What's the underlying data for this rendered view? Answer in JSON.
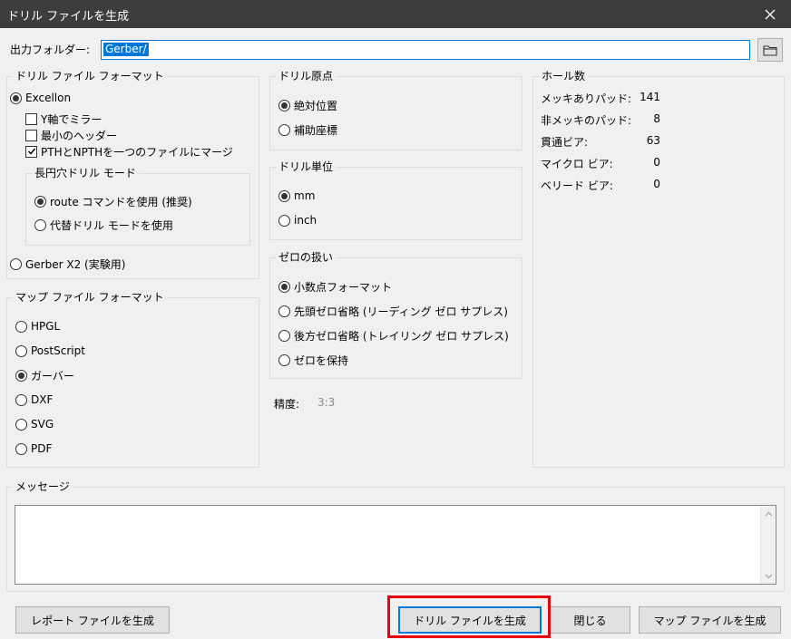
{
  "window": {
    "title": "ドリル ファイルを生成",
    "close_icon": "close-icon"
  },
  "output": {
    "label": "出力フォルダー:",
    "value": "Gerber/",
    "browse_icon": "folder-icon"
  },
  "drill_format": {
    "title": "ドリル ファイル フォーマット",
    "excellon": "Excellon",
    "mirror_y": "Y軸でミラー",
    "min_header": "最小のヘッダー",
    "merge_pth": "PTHとNPTHを一つのファイルにマージ",
    "oval": {
      "title": "長円穴ドリル モード",
      "route": "route コマンドを使用 (推奨)",
      "alt": "代替ドリル モードを使用"
    },
    "gerber_x2": "Gerber X2 (実験用)"
  },
  "map_format": {
    "title": "マップ ファイル フォーマット",
    "options": [
      "HPGL",
      "PostScript",
      "ガーバー",
      "DXF",
      "SVG",
      "PDF"
    ],
    "selected": "ガーバー"
  },
  "origin": {
    "title": "ドリル原点",
    "options": [
      "絶対位置",
      "補助座標"
    ]
  },
  "units": {
    "title": "ドリル単位",
    "options": [
      "mm",
      "inch"
    ]
  },
  "zeros": {
    "title": "ゼロの扱い",
    "options": [
      "小数点フォーマット",
      "先頭ゼロ省略 (リーディング ゼロ サプレス)",
      "後方ゼロ省略 (トレイリング ゼロ サプレス)",
      "ゼロを保持"
    ]
  },
  "precision": {
    "label": "精度:",
    "value": "3:3"
  },
  "holes": {
    "title": "ホール数",
    "rows": [
      {
        "label": "メッキありパッド:",
        "value": "141"
      },
      {
        "label": "非メッキのパッド:",
        "value": "8"
      },
      {
        "label": "貫通ビア:",
        "value": "63"
      },
      {
        "label": "マイクロ ビア:",
        "value": "0"
      },
      {
        "label": "ベリード ビア:",
        "value": "0"
      }
    ]
  },
  "messages": {
    "title": "メッセージ"
  },
  "buttons": {
    "report": "レポート ファイルを生成",
    "drill": "ドリル ファイルを生成",
    "close": "閉じる",
    "map": "マップ ファイルを生成"
  },
  "colors": {
    "accent": "#0078d7",
    "highlight": "#e8000b",
    "titlebar": "#3d3d3d"
  }
}
